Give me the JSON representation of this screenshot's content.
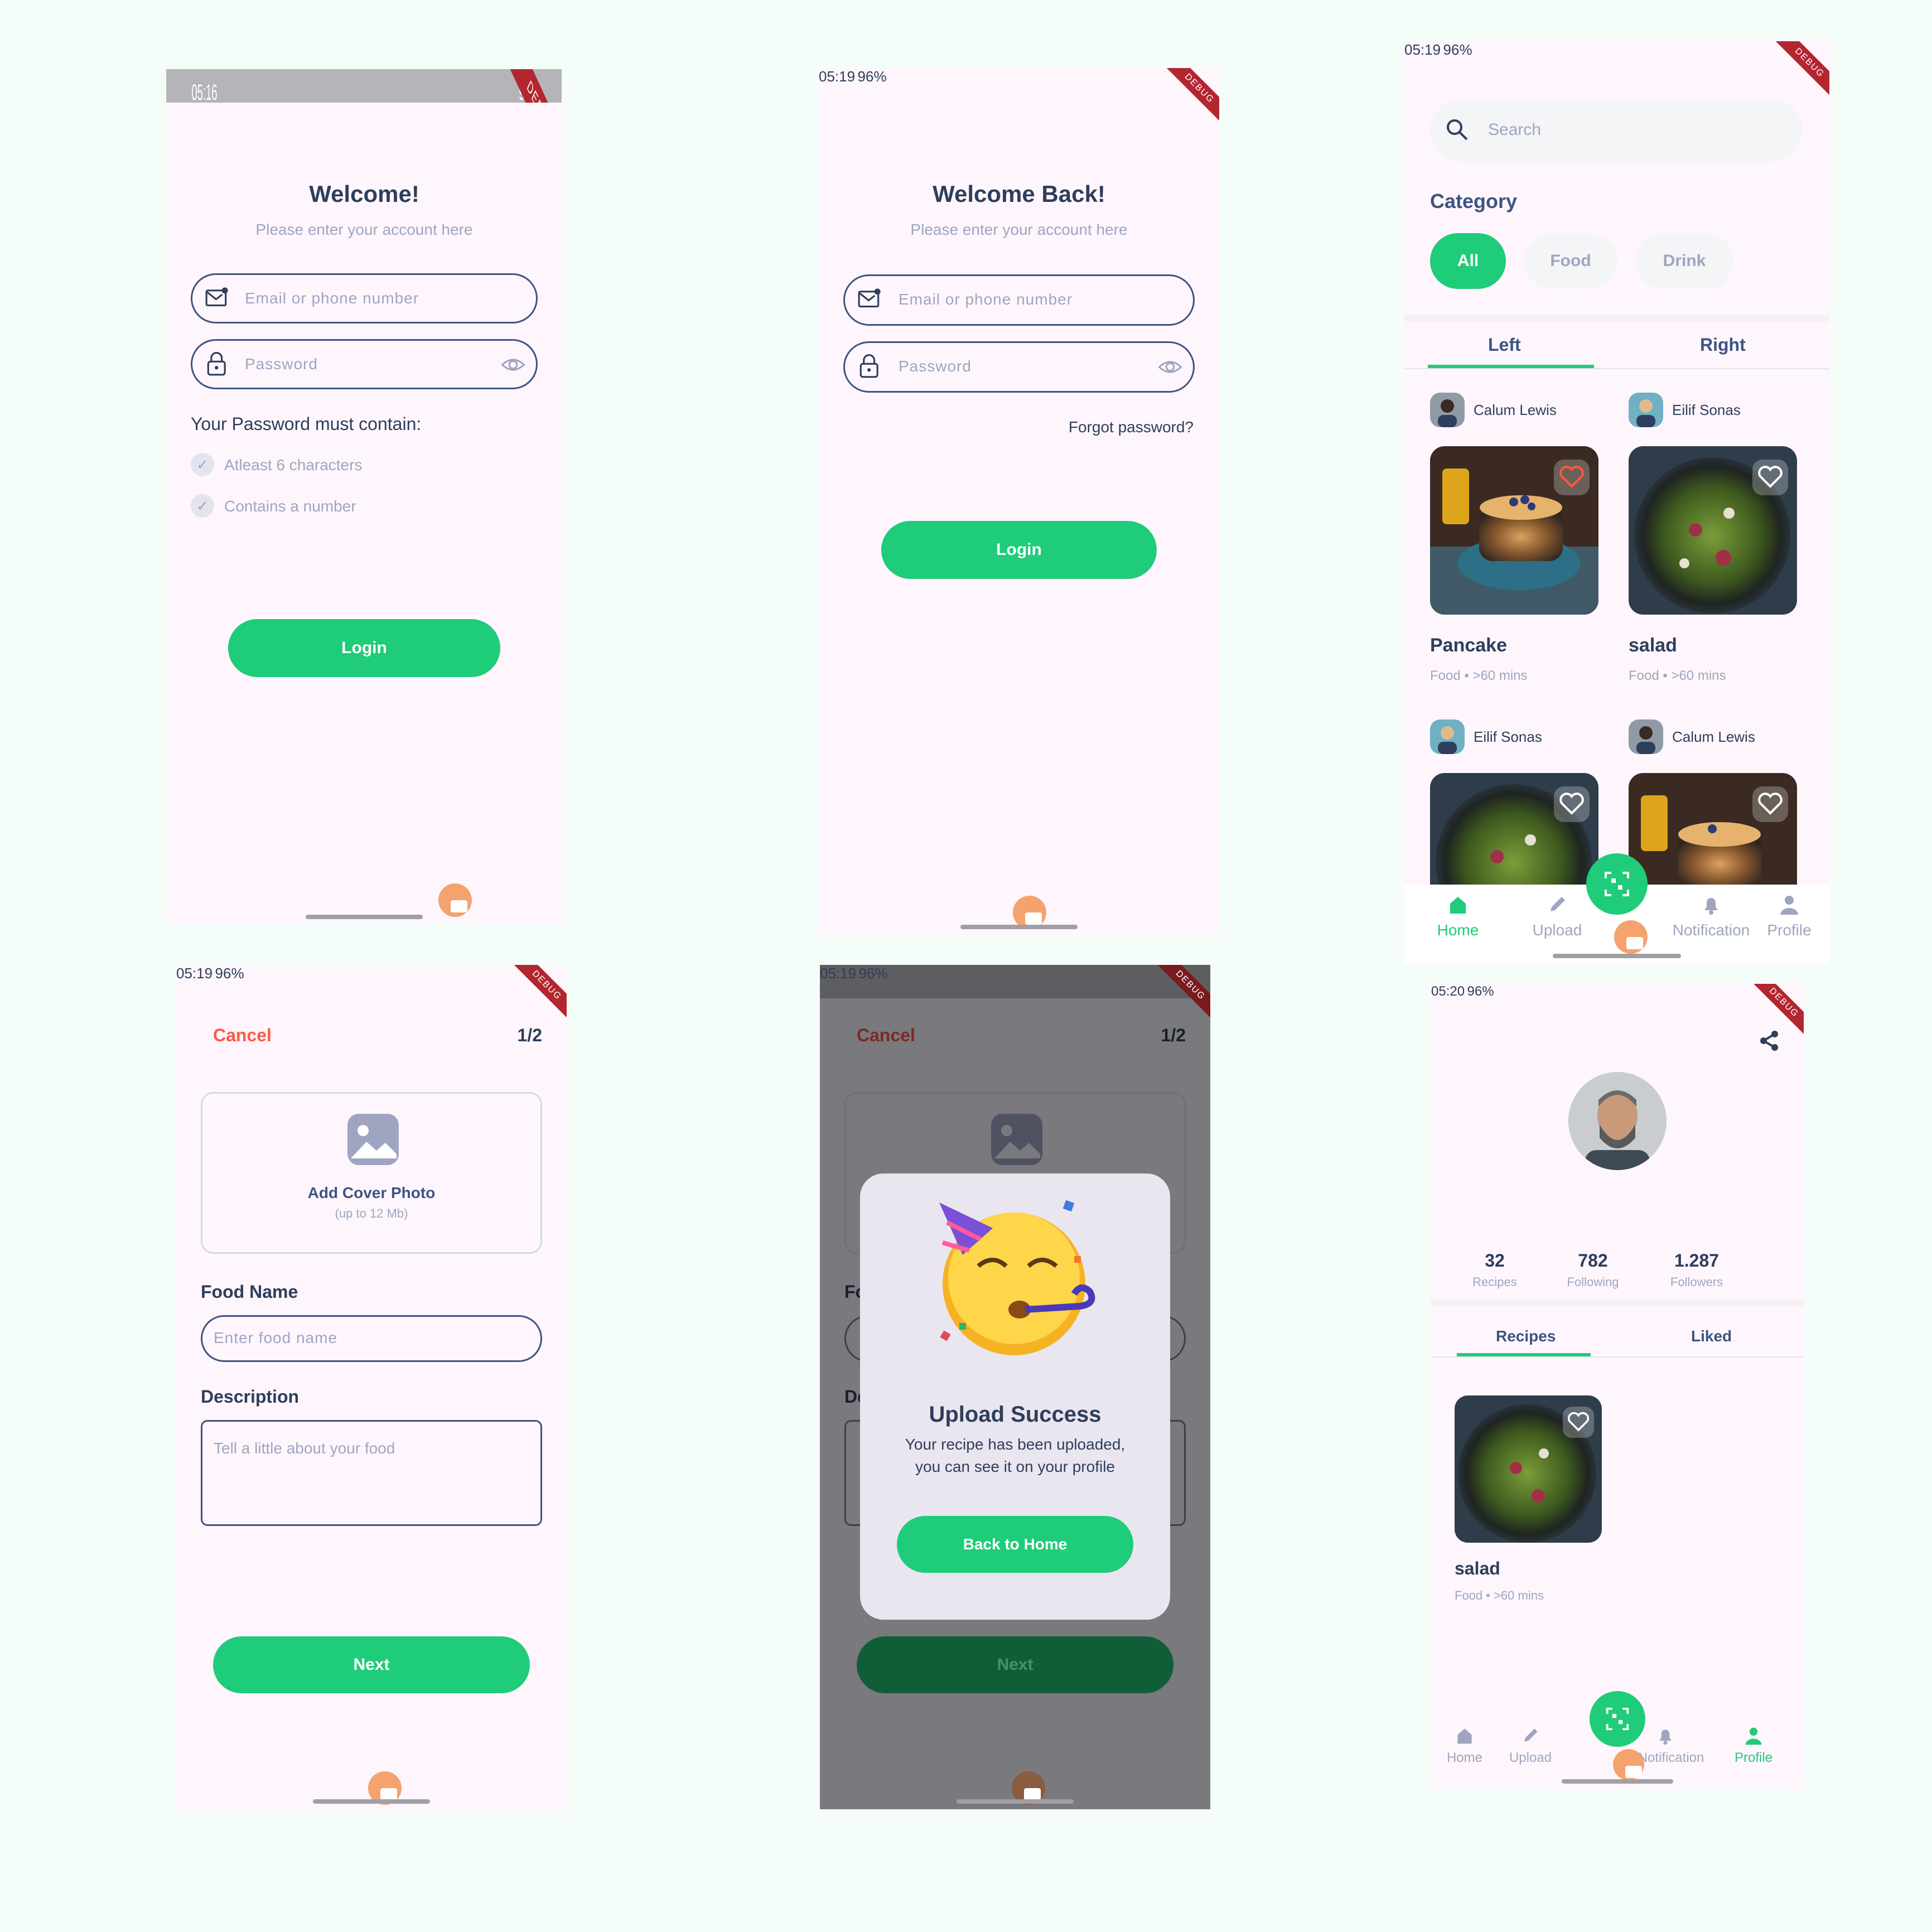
{
  "colors": {
    "primary": "#1fcc79",
    "text": "#2e3e5c",
    "muted": "#9fa5c0",
    "danger": "#ff5842",
    "bg": "#fef6fc"
  },
  "status": {
    "s1_time": "05:16",
    "s2_time": "05:19",
    "s3_time": "05:19",
    "s4_time": "05:19",
    "s5_time": "05:19",
    "s6_time": "05:20",
    "battery": "96%",
    "ribbon": "DEBUG"
  },
  "login1": {
    "title": "Welcome!",
    "subtitle": "Please enter your account here",
    "email_ph": "Email or phone number",
    "password_ph": "Password",
    "rules_title": "Your Password must contain:",
    "rule1": "Atleast 6 characters",
    "rule2": "Contains a number",
    "login": "Login"
  },
  "login2": {
    "title": "Welcome Back!",
    "subtitle": "Please enter your account here",
    "email_ph": "Email or phone number",
    "password_ph": "Password",
    "forgot": "Forgot password?",
    "login": "Login"
  },
  "home": {
    "search_ph": "Search",
    "category": "Category",
    "chips": [
      "All",
      "Food",
      "Drink"
    ],
    "tab_left": "Left",
    "tab_right": "Right",
    "cards": [
      {
        "author": "Calum Lewis",
        "title": "Pancake",
        "meta": "Food •  >60 mins"
      },
      {
        "author": "Eilif Sonas",
        "title": "salad",
        "meta": "Food •  >60 mins"
      },
      {
        "author": "Eilif Sonas"
      },
      {
        "author": "Calum Lewis"
      }
    ],
    "nav": [
      "Home",
      "Upload",
      "Notification",
      "Profile"
    ]
  },
  "upload": {
    "cancel": "Cancel",
    "step": "1/2",
    "add_cover": "Add Cover Photo",
    "cover_hint": "(up to 12 Mb)",
    "food_name": "Food Name",
    "food_name_ph": "Enter food name",
    "description": "Description",
    "description_ph": "Tell a little about your food",
    "next": "Next"
  },
  "success": {
    "cancel": "Cancel",
    "step": "1/2",
    "title": "Upload Success",
    "message_1": "Your recipe has been uploaded,",
    "message_2": "you can see it on your profile",
    "back": "Back to Home",
    "next": "Next",
    "food_label_cut": "Fo",
    "desc_label_cut": "De"
  },
  "profile": {
    "stats": [
      {
        "num": "32",
        "label": "Recipes"
      },
      {
        "num": "782",
        "label": "Following"
      },
      {
        "num": "1.287",
        "label": "Followers"
      }
    ],
    "tab_recipes": "Recipes",
    "tab_liked": "Liked",
    "card_title": "salad",
    "card_meta": "Food •  >60 mins",
    "nav": [
      "Home",
      "Upload",
      "Notification",
      "Profile"
    ]
  }
}
